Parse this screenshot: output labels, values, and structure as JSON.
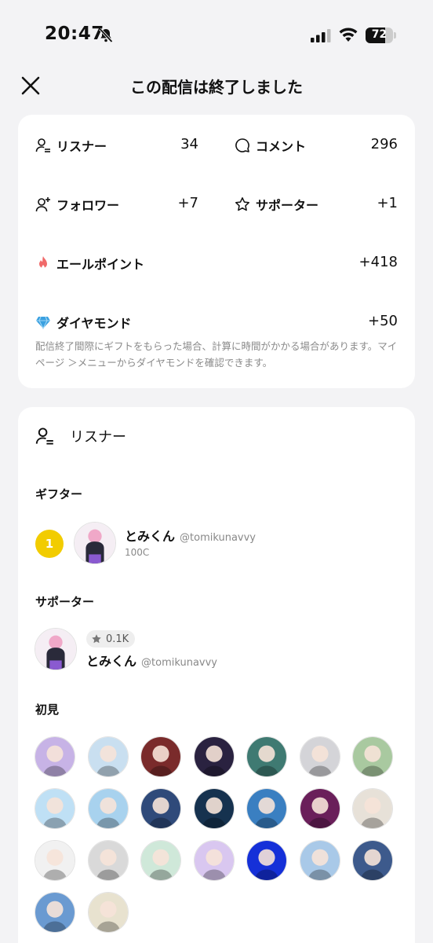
{
  "status_bar": {
    "time": "20:47",
    "battery": "72",
    "battery_level": 0.72
  },
  "header": {
    "title": "この配信は終了しました"
  },
  "stats": {
    "listeners": {
      "label": "リスナー",
      "value": "34"
    },
    "comments": {
      "label": "コメント",
      "value": "296"
    },
    "followers": {
      "label": "フォロワー",
      "value": "+7"
    },
    "supporters": {
      "label": "サポーター",
      "value": "+1"
    },
    "yell_points": {
      "label": "エールポイント",
      "value": "+418"
    },
    "diamonds": {
      "label": "ダイヤモンド",
      "value": "+50"
    },
    "note": "配信終了間際にギフトをもらった場合、計算に時間がかかる場合があります。マイページ ＞メニューからダイヤモンドを確認できます。"
  },
  "listeners_section": {
    "title": "リスナー",
    "gifters": {
      "title": "ギフター",
      "items": [
        {
          "rank": "1",
          "name": "とみくん",
          "handle": "@tomikunavvy",
          "amount": "100C"
        }
      ]
    },
    "supporters": {
      "title": "サポーター",
      "items": [
        {
          "badge": "0.1K",
          "name": "とみくん",
          "handle": "@tomikunavvy"
        }
      ]
    },
    "first_time": {
      "title": "初見",
      "avatar_colors": [
        "#c7b3e6",
        "#c9dff0",
        "#7a2b2b",
        "#2a2240",
        "#3f7a72",
        "#d4d4d8",
        "#a9c9a0",
        "#bfe0f5",
        "#a8d2ee",
        "#2f4a7a",
        "#16324f",
        "#3a7fc1",
        "#6a1f5a",
        "#e7e1d8",
        "#f1f1f1",
        "#d9d9d9",
        "#cfe8d9",
        "#d9c7f0",
        "#1530d8",
        "#a9c9e8",
        "#3d5a8c",
        "#6a9ad1",
        "#e8e2cf"
      ]
    }
  }
}
